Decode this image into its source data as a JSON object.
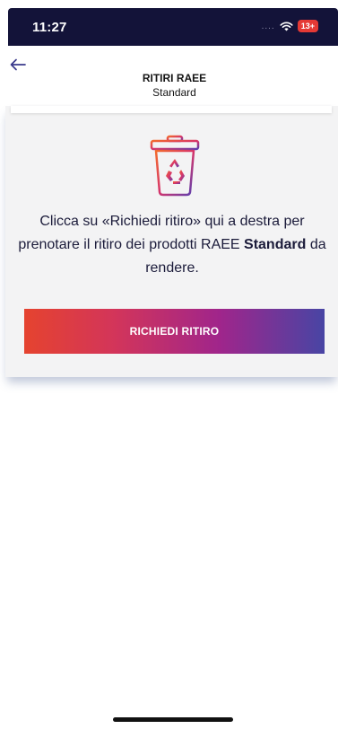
{
  "status_bar": {
    "time": "11:27",
    "signal": "....",
    "battery": "13+"
  },
  "header": {
    "title": "RITIRI RAEE",
    "subtitle": "Standard"
  },
  "card": {
    "instruction_part1": "Clicca su «Richiedi ritiro» qui a destra per prenotare il ritiro dei prodotti RAEE ",
    "instruction_bold": "Standard",
    "instruction_part2": " da rendere.",
    "button_label": "RICHIEDI RITIRO"
  },
  "colors": {
    "status_bar_bg": "#131339",
    "gradient_start": "#e5432f",
    "gradient_end": "#4845a4",
    "text": "#1b1b3a"
  }
}
